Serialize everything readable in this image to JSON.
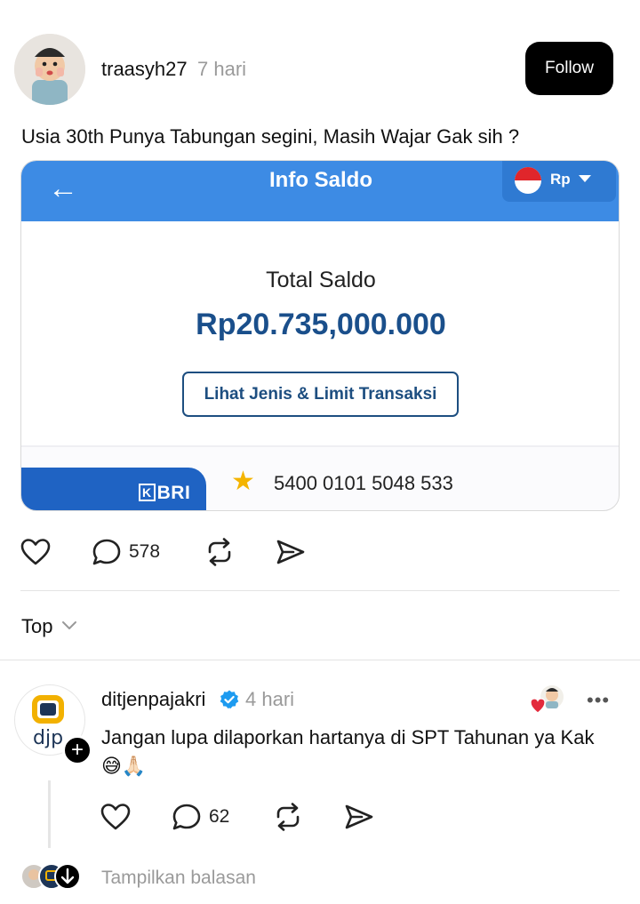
{
  "post": {
    "username": "traasyh27",
    "time": "7 hari",
    "follow_label": "Follow",
    "text": "Usia 30th Punya Tabungan segini, Masih Wajar Gak sih ?",
    "comment_count": "578"
  },
  "embed": {
    "back_glyph": "←",
    "title": "Info Saldo",
    "currency": "Rp",
    "saldo_label": "Total Saldo",
    "saldo_value": "Rp20.735,000.000",
    "limit_button": "Lihat Jenis & Limit Transaksi",
    "bank_logo_box": "K",
    "bank_logo_text": "BRI",
    "star": "★",
    "account_number": "5400 0101 5048 533"
  },
  "sort": {
    "label": "Top"
  },
  "reply": {
    "username": "ditjenpajakri",
    "time": "4 hari",
    "text": "Jangan lupa dilaporkan hartanya di SPT Tahunan ya Kak 😅🙏🏻",
    "comment_count": "62",
    "more": "•••",
    "plus": "+"
  },
  "show_replies": "Tampilkan balasan",
  "colors": {
    "bank_blue": "#3d8be4",
    "saldo_blue": "#1a4f8b",
    "bri_blue": "#1f63c3",
    "verified_blue": "#1d9bf0"
  },
  "icons": [
    "heart-icon",
    "comment-icon",
    "repost-icon",
    "share-icon",
    "chevron-down-icon",
    "verified-icon",
    "more-icon"
  ]
}
